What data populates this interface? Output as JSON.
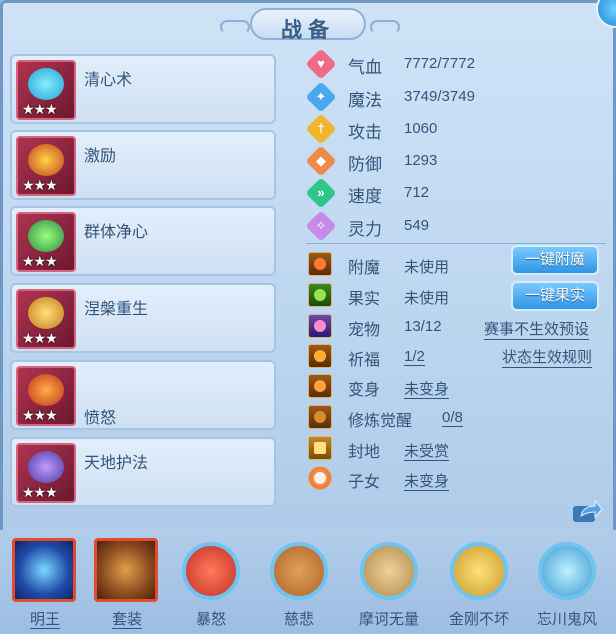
{
  "title": "战备",
  "skills": [
    {
      "name": "清心术",
      "stars": "★★★"
    },
    {
      "name": "激励",
      "stars": "★★★"
    },
    {
      "name": "群体净心",
      "stars": "★★★"
    },
    {
      "name": "涅槃重生",
      "stars": "★★★"
    },
    {
      "name": "愤怒",
      "stars": "★★★"
    },
    {
      "name": "天地护法",
      "stars": "★★★"
    }
  ],
  "stats": [
    {
      "label": "气血",
      "value": "7772/7772",
      "icon": "heart-icon",
      "color": "#f06a86",
      "glyph": "♥"
    },
    {
      "label": "魔法",
      "value": "3749/3749",
      "icon": "mana-icon",
      "color": "#4aa8ec",
      "glyph": "✦"
    },
    {
      "label": "攻击",
      "value": "1060",
      "icon": "attack-icon",
      "color": "#f2b52e",
      "glyph": "†"
    },
    {
      "label": "防御",
      "value": "1293",
      "icon": "defense-icon",
      "color": "#f08a4a",
      "glyph": "◆"
    },
    {
      "label": "速度",
      "value": "712",
      "icon": "speed-icon",
      "color": "#2fc68a",
      "glyph": "»"
    },
    {
      "label": "灵力",
      "value": "549",
      "icon": "spirit-icon",
      "color": "#c78ae6",
      "glyph": "✧"
    }
  ],
  "info": {
    "enchant": {
      "label": "附魔",
      "value": "未使用"
    },
    "fruit": {
      "label": "果实",
      "value": "未使用"
    },
    "pet": {
      "label": "宠物",
      "value": "13/12"
    },
    "blessing": {
      "label": "祈福",
      "value": "1/2"
    },
    "transform": {
      "label": "变身",
      "value": "未变身"
    },
    "cultivation": {
      "label": "修炼觉醒",
      "value": "0/8"
    },
    "fief": {
      "label": "封地",
      "value": "未受赏"
    },
    "child": {
      "label": "子女",
      "value": "未变身"
    }
  },
  "buttons": {
    "one_key_enchant": "一键附魔",
    "one_key_fruit": "一键果实"
  },
  "links": {
    "event_invalid_preset": "赛事不生效预设",
    "status_rules": "状态生效规则"
  },
  "bottom": [
    {
      "label": "明王",
      "shape": "square",
      "color": "#1f4aa8"
    },
    {
      "label": "套装",
      "shape": "square",
      "color": "#8a4a20"
    },
    {
      "label": "暴怒",
      "shape": "circle",
      "color": "#c2302a"
    },
    {
      "label": "慈悲",
      "shape": "circle",
      "color": "#b0632a"
    },
    {
      "label": "摩诃无量",
      "shape": "circle",
      "color": "#b08a4a"
    },
    {
      "label": "金刚不坏",
      "shape": "circle",
      "color": "#c99a2a"
    },
    {
      "label": "忘川鬼风",
      "shape": "circle",
      "color": "#3a9ad0"
    }
  ]
}
